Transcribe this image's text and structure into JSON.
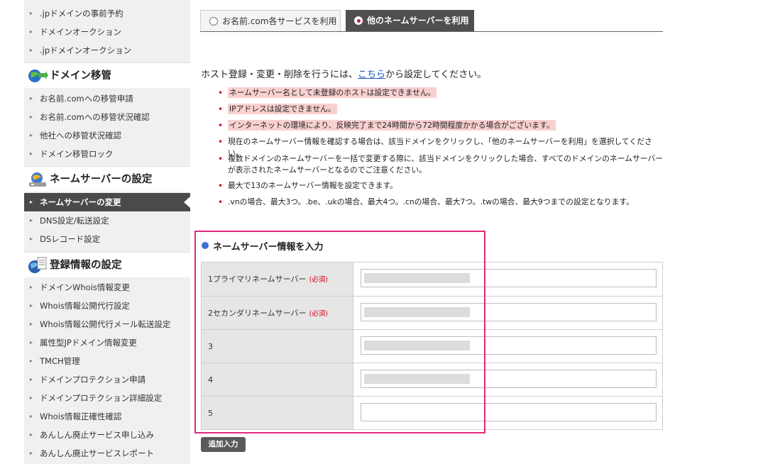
{
  "sidebar": {
    "group0_items": [
      {
        "label": ".jpドメインの事前予約"
      },
      {
        "label": "ドメインオークション"
      },
      {
        "label": ".jpドメインオークション"
      }
    ],
    "group1": {
      "title": "ドメイン移管",
      "icon": "globe-arrow-icon",
      "items": [
        {
          "label": "お名前.comへの移管申請"
        },
        {
          "label": "お名前.comへの移管状況確認"
        },
        {
          "label": "他社への移管状況確認"
        },
        {
          "label": "ドメイン移管ロック"
        }
      ]
    },
    "group2": {
      "title": "ネームサーバーの設定",
      "icon": "server-globe-icon",
      "items": [
        {
          "label": "ネームサーバーの変更",
          "active": true
        },
        {
          "label": "DNS設定/転送設定"
        },
        {
          "label": "DSレコード設定"
        }
      ]
    },
    "group3": {
      "title": "登録情報の設定",
      "icon": "document-globe-icon",
      "items": [
        {
          "label": "ドメインWhois情報変更"
        },
        {
          "label": "Whois情報公開代行設定"
        },
        {
          "label": "Whois情報公開代行メール転送設定"
        },
        {
          "label": "属性型JPドメイン情報変更"
        },
        {
          "label": "TMCH管理"
        },
        {
          "label": "ドメインプロテクション申請"
        },
        {
          "label": "ドメインプロテクション詳細設定"
        },
        {
          "label": "Whois情報正確性確認"
        },
        {
          "label": "あんしん廃止サービス申し込み"
        },
        {
          "label": "あんしん廃止サービスレポート"
        }
      ]
    }
  },
  "tabs": [
    {
      "label": "お名前.com各サービスを利用",
      "selected": false
    },
    {
      "label": "他のネームサーバーを利用",
      "selected": true
    }
  ],
  "intro": {
    "before": "ホスト登録・変更・削除を行うには、",
    "link": "こちら",
    "after": "から設定してください。"
  },
  "notes": [
    {
      "text": "ネームサーバー名として未登録のホストは設定できません。",
      "highlight": true
    },
    {
      "text": "IPアドレスは設定できません。",
      "highlight": true
    },
    {
      "text": "インターネットの環境により、反映完了まで24時間から72時間程度かかる場合がございます。",
      "highlight": true
    },
    {
      "text": "現在のネームサーバー情報を確認する場合は、該当ドメインをクリックし、「他のネームサーバーを利用」を選択してください。",
      "highlight": false
    },
    {
      "text": "複数ドメインのネームサーバーを一括で変更する際に、該当ドメインをクリックした場合、すべてのドメインのネームサーバーが表示されたネームサーバーとなるのでご注意ください。",
      "highlight": false
    },
    {
      "text": "最大で13のネームサーバー情報を設定できます。",
      "highlight": false
    },
    {
      "text": ".vnの場合、最大3つ。.be、.ukの場合、最大4つ。.cnの場合、最大7つ。.twの場合、最大9つまでの設定となります。",
      "highlight": false
    }
  ],
  "form": {
    "title": "ネームサーバー情報を入力",
    "required_label": "(必須)",
    "rows": [
      {
        "label": "1プライマリネームサーバー",
        "required": true,
        "value": "",
        "redacted": true
      },
      {
        "label": "2セカンダリネームサーバー",
        "required": true,
        "value": "",
        "redacted": true
      },
      {
        "label": "3",
        "required": false,
        "value": "",
        "redacted": true
      },
      {
        "label": "4",
        "required": false,
        "value": "",
        "redacted": true
      },
      {
        "label": "5",
        "required": false,
        "value": "",
        "redacted": false
      }
    ],
    "add_button": "追加入力"
  },
  "colors": {
    "highlight_box": "#e0287a",
    "note_highlight": "#f9d0d0",
    "bullet": "#d0021b",
    "link": "#1a57b8",
    "active_nav": "#4a4a4a"
  }
}
